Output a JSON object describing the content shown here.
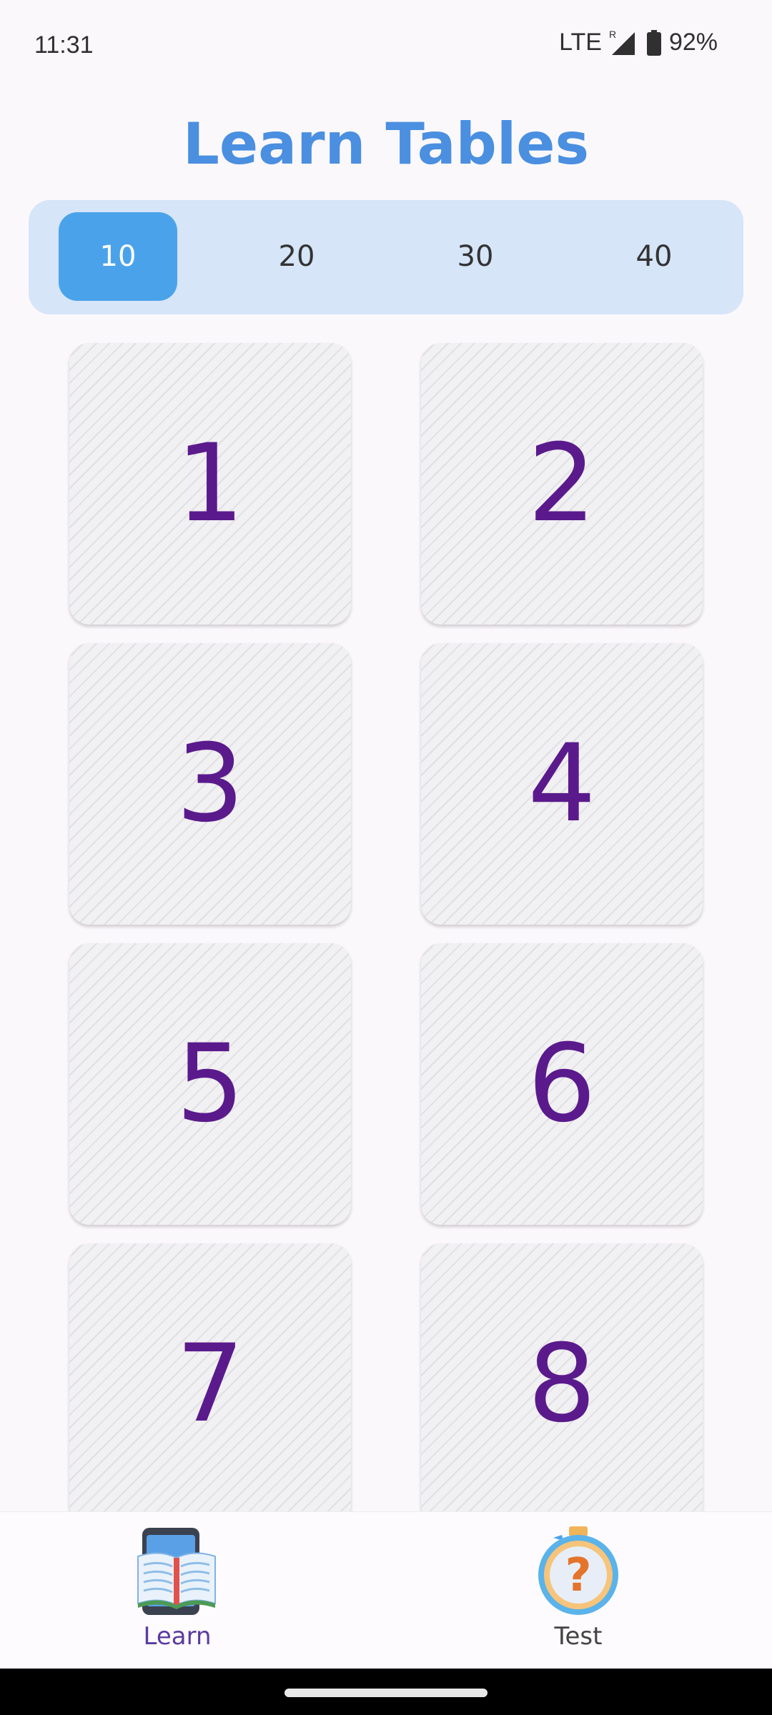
{
  "status_bar": {
    "time": "11:31",
    "network": "LTE",
    "roaming_indicator": "R",
    "battery": "92%",
    "icons": [
      "signal-icon",
      "battery-icon"
    ]
  },
  "title": "Learn Tables",
  "tabs": [
    {
      "label": "10",
      "active": true
    },
    {
      "label": "20",
      "active": false
    },
    {
      "label": "30",
      "active": false
    },
    {
      "label": "40",
      "active": false
    }
  ],
  "cards": [
    "1",
    "2",
    "3",
    "4",
    "5",
    "6",
    "7",
    "8"
  ],
  "bottom_nav": {
    "learn": {
      "label": "Learn",
      "icon": "open-book-phone-icon",
      "active": true
    },
    "test": {
      "label": "Test",
      "icon": "question-stopwatch-icon",
      "active": false
    }
  },
  "colors": {
    "title": "#4a8fe0",
    "tab_bar_bg": "#d6e5f8",
    "tab_active_bg": "#4aa3ea",
    "card_number": "#5a1a8c",
    "nav_active_label": "#5b3aa0"
  }
}
